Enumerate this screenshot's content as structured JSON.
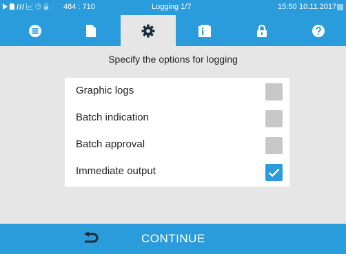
{
  "status": {
    "coords": "484 : 710",
    "title": "Logging 1/7",
    "time": "15:50",
    "date": "10.11.2017"
  },
  "tabs": [
    {
      "icon": "list-icon",
      "active": false
    },
    {
      "icon": "document-icon",
      "active": false
    },
    {
      "icon": "gear-icon",
      "active": true
    },
    {
      "icon": "info-card-icon",
      "active": false
    },
    {
      "icon": "lock-icon",
      "active": false
    },
    {
      "icon": "help-icon",
      "active": false
    }
  ],
  "main": {
    "prompt": "Specify the options for logging",
    "options": [
      {
        "label": "Graphic logs",
        "checked": false
      },
      {
        "label": "Batch indication",
        "checked": false
      },
      {
        "label": "Batch approval",
        "checked": false
      },
      {
        "label": "Immediate output",
        "checked": true
      }
    ]
  },
  "footer": {
    "continue_label": "CONTINUE"
  },
  "colors": {
    "accent": "#2a9cdc",
    "background": "#e6e6e6",
    "checkbox_off": "#c8c8c8"
  }
}
